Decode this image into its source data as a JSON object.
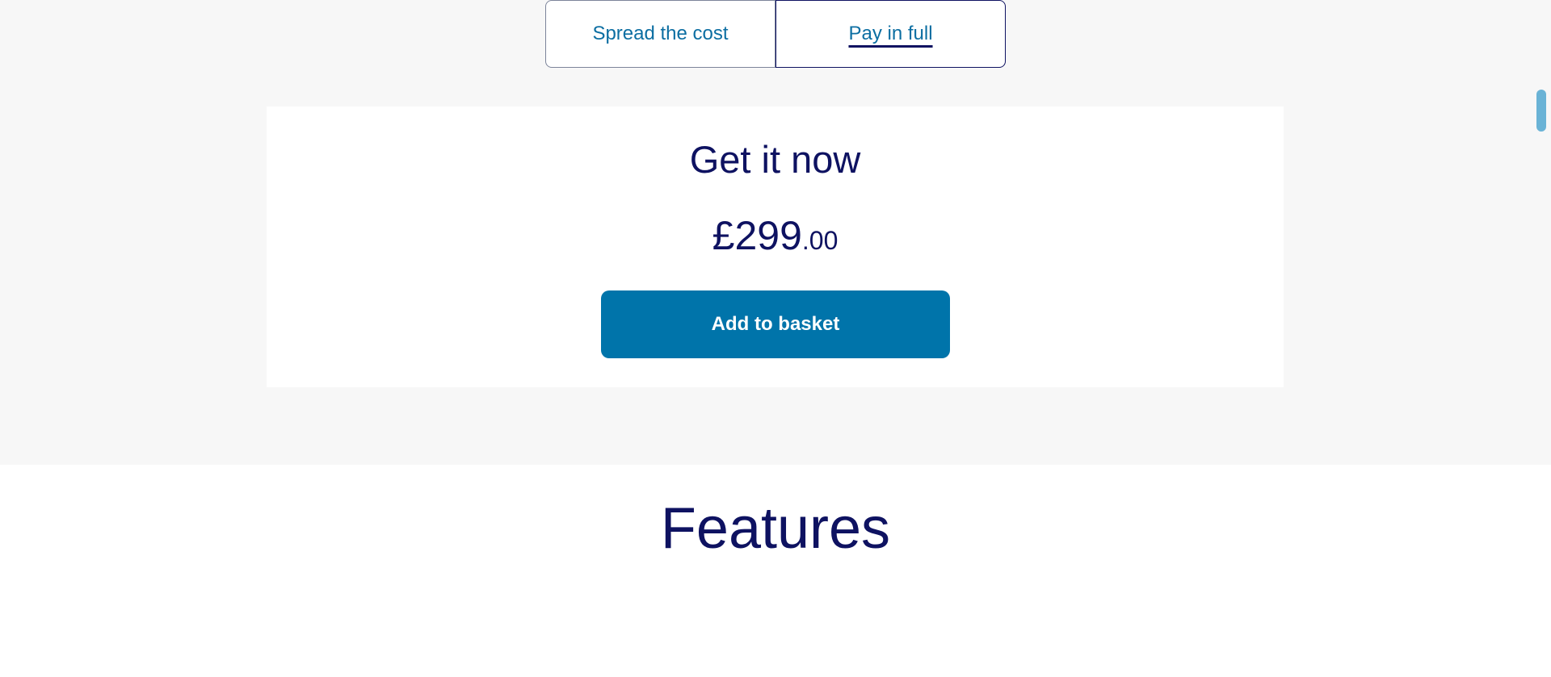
{
  "payment_toggle": {
    "options": [
      {
        "label": "Spread the cost",
        "selected": false
      },
      {
        "label": "Pay in full",
        "selected": true
      }
    ]
  },
  "purchase_card": {
    "title": "Get it now",
    "price_major": "£299",
    "price_minor": ".00",
    "add_button_label": "Add to basket"
  },
  "features_section": {
    "title": "Features"
  },
  "colors": {
    "navy_text": "#0e1261",
    "link_blue": "#0c6ea2",
    "button_blue": "#0074aa",
    "section_grey": "#f7f7f7",
    "scrollbar": "#6ab3d6"
  }
}
